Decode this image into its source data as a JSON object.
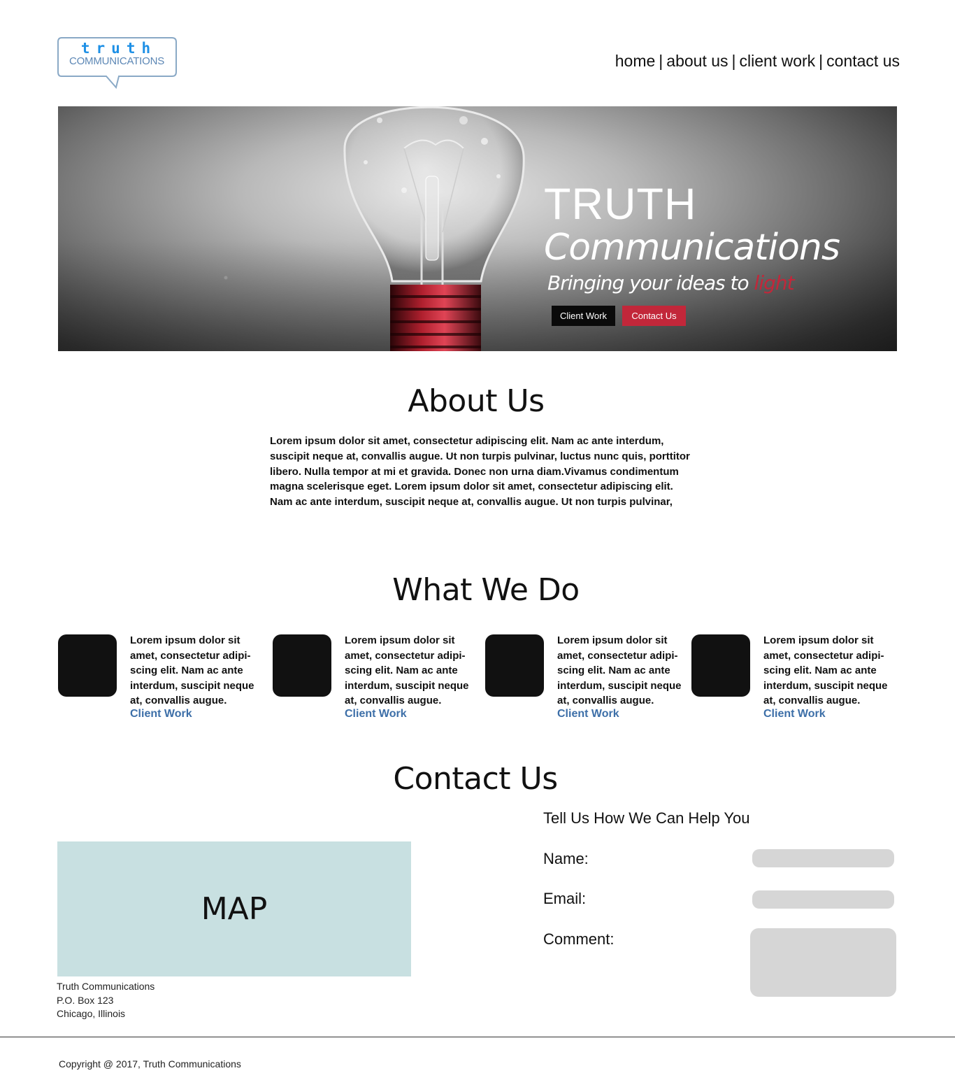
{
  "header": {
    "logo": {
      "top_text": "truth",
      "bottom_text": "COMMUNICATIONS"
    },
    "nav": [
      {
        "label": "home"
      },
      {
        "label": "about us"
      },
      {
        "label": "client work"
      },
      {
        "label": "contact us"
      }
    ],
    "nav_separator": "|"
  },
  "hero": {
    "title": "TRUTH",
    "subtitle": "Communications",
    "tagline_main": "Bringing your ideas to",
    "tagline_accent": "light",
    "buttons": {
      "client_work": "Client Work",
      "contact_us": "Contact Us"
    }
  },
  "about": {
    "heading": "About Us",
    "body": "Lorem ipsum dolor sit amet, consectetur adipiscing elit. Nam ac ante interdum, suscipit neque at, convallis augue. Ut non turpis pulvinar, luctus nunc quis, porttitor libero. Nulla tempor at mi et gravida. Donec non urna diam.Vivamus condimentum magna scelerisque eget.  Lorem ipsum dolor sit amet, consectetur adipiscing elit. Nam ac ante interdum, suscipit neque at, convallis augue. Ut non turpis pulvinar,"
  },
  "what_we_do": {
    "heading": "What We Do",
    "services": [
      {
        "text": "Lorem ipsum dolor sit amet, consectetur adipi-scing elit. Nam ac ante interdum, suscipit neque at, convallis augue.",
        "link": "Client Work"
      },
      {
        "text": "Lorem ipsum dolor sit amet, consectetur adipi-scing elit. Nam ac ante interdum, suscipit neque at, convallis augue.",
        "link": "Client Work"
      },
      {
        "text": "Lorem ipsum dolor sit amet, consectetur adipi-scing elit. Nam ac ante interdum, suscipit neque at, convallis augue.",
        "link": "Client Work"
      },
      {
        "text": "Lorem ipsum dolor sit amet, consectetur adipi-scing elit. Nam ac ante interdum, suscipit neque at, convallis augue.",
        "link": "Client Work"
      }
    ]
  },
  "contact": {
    "heading": "Contact Us",
    "map_label": "MAP",
    "address": {
      "line1": "Truth Communications",
      "line2": "P.O. Box 123",
      "line3": "Chicago, Illinois"
    },
    "form": {
      "title": "Tell Us How We Can Help You",
      "name_label": "Name:",
      "email_label": "Email:",
      "comment_label": "Comment:"
    }
  },
  "footer": {
    "copyright": "Copyright @ 2017, Truth Communications"
  },
  "colors": {
    "accent_red": "#c2273a",
    "link_blue": "#3d6fa8",
    "logo_blue": "#1e90e6",
    "map_bg": "#c8e0e1",
    "field_bg": "#d6d6d6"
  }
}
